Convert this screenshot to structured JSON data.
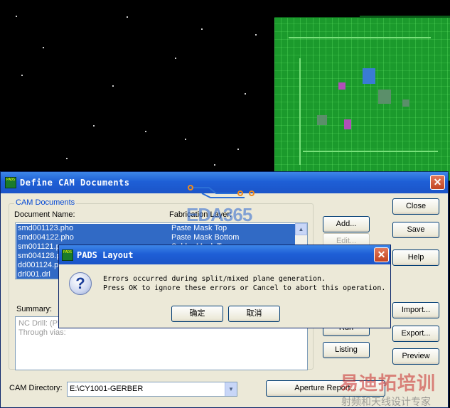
{
  "cam_dialog": {
    "title": "Define CAM Documents",
    "group_label": "CAM Documents",
    "col_document_name": "Document Name:",
    "col_fabrication_layer": "Fabrication Layer:",
    "documents": [
      {
        "name": "smd001123.pho",
        "layer": "Paste Mask Top"
      },
      {
        "name": "smd004122.pho",
        "layer": "Paste Mask Bottom"
      },
      {
        "name": "sm001121.p",
        "layer": "Solder Mask Top"
      },
      {
        "name": "sm004128.p",
        "layer": ""
      },
      {
        "name": "dd001124.p",
        "layer": ""
      },
      {
        "name": "drl001.drl",
        "layer": ""
      }
    ],
    "summary_label": "Summary:",
    "summary_lines": [
      "NC Drill: (Pla",
      "Through vias:"
    ],
    "buttons": {
      "add": "Add...",
      "edit": "Edit...",
      "run": "Run",
      "listing": "Listing",
      "close": "Close",
      "save": "Save",
      "help": "Help",
      "import": "Import...",
      "export": "Export...",
      "preview": "Preview",
      "aperture_report": "Aperture Report..."
    },
    "cam_directory_label": "CAM Directory:",
    "cam_directory_value": "E:\\CY1001-GERBER"
  },
  "message_box": {
    "title": "PADS Layout",
    "line1": "Errors occurred during split/mixed plane generation.",
    "line2": "Press OK to ignore these errors or Cancel to abort this operation.",
    "ok_label": "确定",
    "cancel_label": "取消",
    "icon": "question-icon"
  },
  "watermark": {
    "logo": "EDA365",
    "cn_main": "易迪拓培训",
    "cn_sub": "射频和天线设计专家"
  },
  "app_icon_text": "PADS",
  "colors": {
    "title_bar": "#1e5fd6",
    "selection": "#316ac5",
    "dialog_bg": "#ece9d8",
    "pcb_green": "#1b9a2c"
  }
}
